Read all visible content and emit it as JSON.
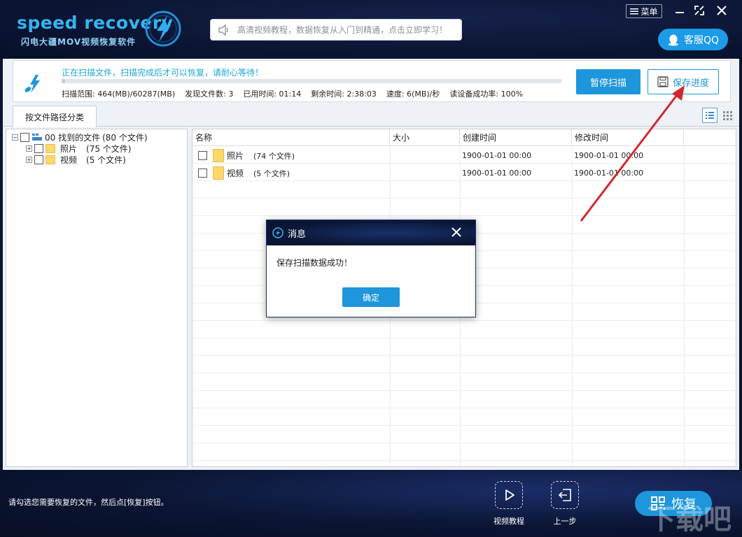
{
  "header": {
    "logo_text": "speed recovery",
    "logo_subtitle": "闪电大疆MOV视频恢复软件",
    "banner_text": "高清视频教程，数据恢复从入门到精通，点击立即学习！",
    "menu_label": "菜单",
    "qq_label": "客服QQ"
  },
  "status": {
    "message": "正在扫描文件，扫描完成后才可以恢复，请耐心等待！",
    "progress_fraction": 0.0077,
    "range": "扫描范围: 464(MB)/60287(MB)",
    "found": "发现文件数: 3",
    "elapsed": "已用时间: 01:14",
    "remaining": "剩余时间: 2:38:03",
    "speed": "速度: 6(MB)/秒",
    "success_rate": "读设备成功率: 100%",
    "pause_label": "暂停扫描",
    "save_label": "保存进度"
  },
  "tabs": {
    "path_label": "按文件路径分类"
  },
  "tree": {
    "root": {
      "label": "00 找到的文件",
      "count": "(80 个文件)"
    },
    "children": [
      {
        "label": "照片",
        "count": "(75 个文件)"
      },
      {
        "label": "视频",
        "count": "(5 个文件)"
      }
    ]
  },
  "list": {
    "columns": [
      "名称",
      "大小",
      "创建时间",
      "修改时间"
    ],
    "rows": [
      {
        "name": "照片",
        "count": "(74 个文件)",
        "size": "",
        "created": "1900-01-01  00:00",
        "modified": "1900-01-01  00:00"
      },
      {
        "name": "视频",
        "count": "(5 个文件)",
        "size": "",
        "created": "1900-01-01  00:00",
        "modified": "1900-01-01  00:00"
      }
    ]
  },
  "dialog": {
    "title": "消息",
    "message": "保存扫描数据成功！",
    "ok_label": "确定"
  },
  "footer": {
    "hint": "请勾选您需要恢复的文件，然后点[恢复]按钮。",
    "tutorial_label": "视频教程",
    "back_label": "上一步",
    "restore_label": "恢复",
    "watermark": "下载吧"
  },
  "colors": {
    "brand": "#1d96db",
    "dark_bg": "#0b1533",
    "scan_msg": "#19a7d6",
    "arrow": "#d0282c"
  }
}
